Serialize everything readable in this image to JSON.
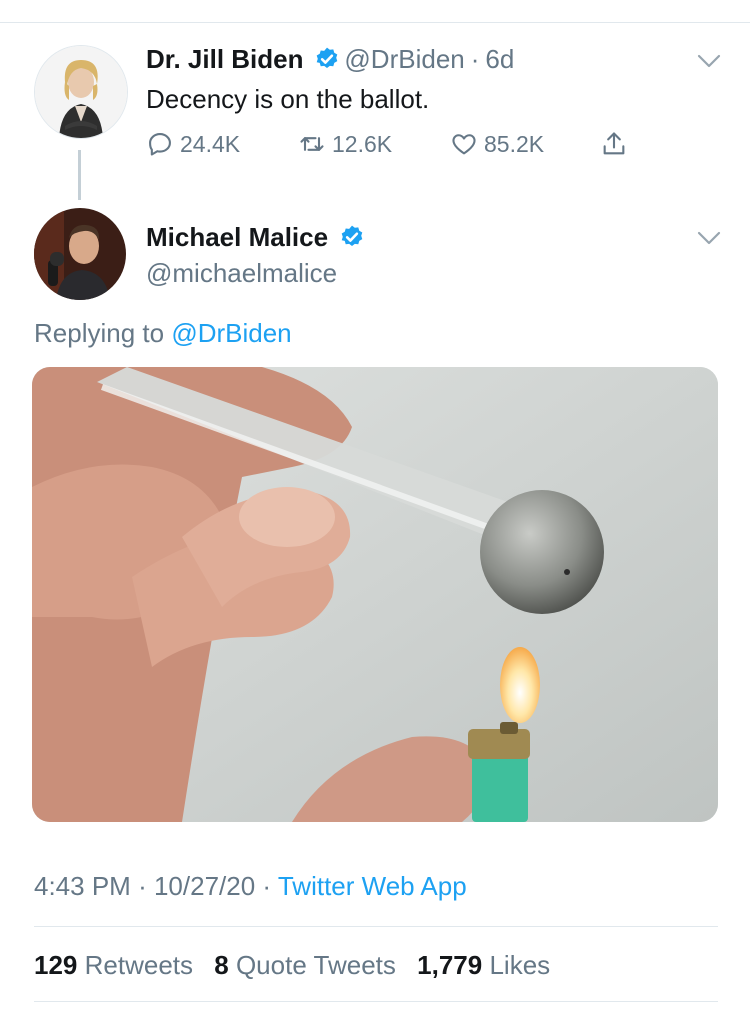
{
  "original_tweet": {
    "display_name": "Dr. Jill Biden",
    "handle": "@DrBiden",
    "time_sep": "·",
    "age": "6d",
    "text": "Decency is on the ballot.",
    "actions": {
      "replies": "24.4K",
      "retweets": "12.6K",
      "likes": "85.2K"
    }
  },
  "reply_tweet": {
    "display_name": "Michael Malice",
    "handle": "@michaelmalice",
    "replying_prefix": "Replying to",
    "replying_handle": "@DrBiden",
    "time": "4:43 PM",
    "sep1": "·",
    "date": "10/27/20",
    "sep2": "·",
    "source": "Twitter Web App",
    "stats": {
      "retweets_count": "129",
      "retweets_label": "Retweets",
      "quote_count": "8",
      "quote_label": "Quote Tweets",
      "likes_count": "1,779",
      "likes_label": "Likes"
    }
  },
  "colors": {
    "accent": "#1da1f2",
    "secondary_text": "#657786",
    "primary_text": "#14171a",
    "divider": "#e1e8ed"
  },
  "icons": [
    "reply-icon",
    "retweet-icon",
    "like-icon",
    "share-icon",
    "verified-icon",
    "chevron-down-icon"
  ]
}
